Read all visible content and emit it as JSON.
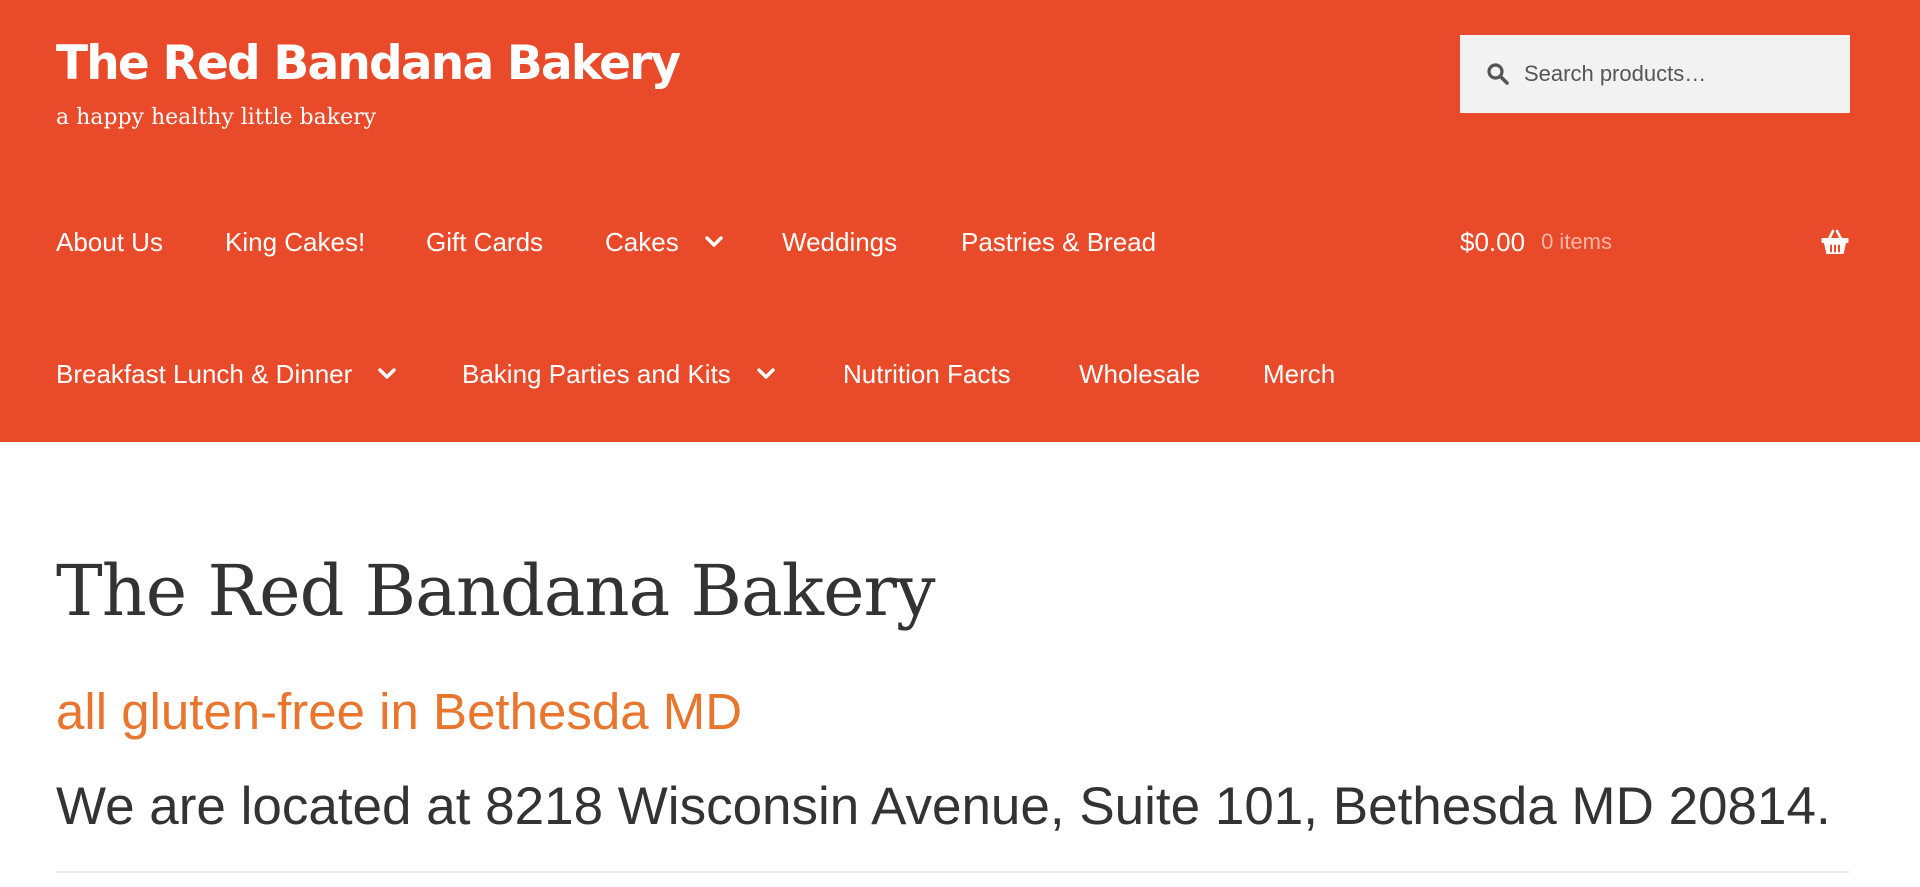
{
  "header": {
    "site_title": "The Red Bandana Bakery",
    "tagline": "a happy healthy little bakery",
    "search_placeholder": "Search products…",
    "brand_color": "#e84a2a"
  },
  "nav": {
    "items": [
      {
        "label": "About Us",
        "has_dropdown": false
      },
      {
        "label": "King Cakes!",
        "has_dropdown": false
      },
      {
        "label": "Gift Cards",
        "has_dropdown": false
      },
      {
        "label": "Cakes",
        "has_dropdown": true
      },
      {
        "label": "Weddings",
        "has_dropdown": false
      },
      {
        "label": "Pastries & Bread",
        "has_dropdown": false
      },
      {
        "label": "Breakfast Lunch & Dinner",
        "has_dropdown": true
      },
      {
        "label": "Baking Parties and Kits",
        "has_dropdown": true
      },
      {
        "label": "Nutrition Facts",
        "has_dropdown": false
      },
      {
        "label": "Wholesale",
        "has_dropdown": false
      },
      {
        "label": "Merch",
        "has_dropdown": false
      }
    ]
  },
  "cart": {
    "amount": "$0.00",
    "count": "0 items",
    "icon": "basket-icon"
  },
  "main": {
    "title": "The Red Bandana Bakery",
    "subtitle": "all gluten-free in Bethesda MD",
    "address": "We are located at 8218 Wisconsin Avenue, Suite 101, Bethesda MD 20814.",
    "subtitle_color": "#e8762e"
  }
}
